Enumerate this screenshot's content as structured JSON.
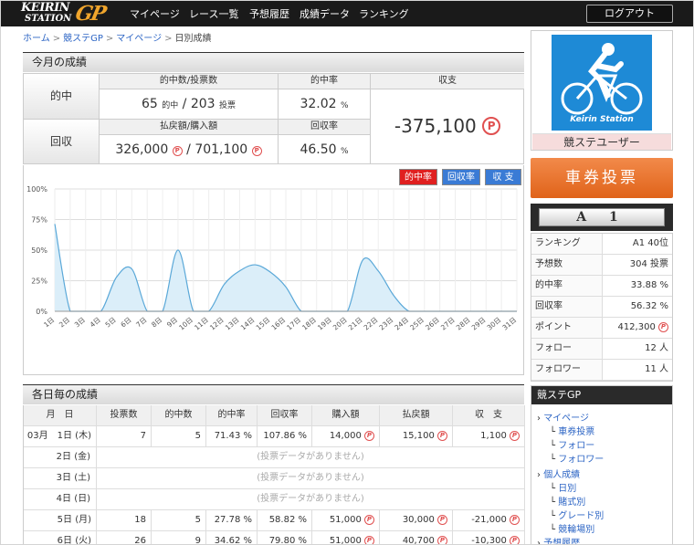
{
  "header": {
    "logo_top": "KEIRIN",
    "logo_bottom": "STATION",
    "logo_gp": "GP",
    "nav": [
      "マイページ",
      "レース一覧",
      "予想履歴",
      "成績データ",
      "ランキング"
    ],
    "logout": "ログアウト"
  },
  "breadcrumb": [
    "ホーム",
    "競ステGP",
    "マイページ",
    "日別成績"
  ],
  "month": {
    "title": "今月の成績",
    "hit_label": "的中",
    "recovery_label": "回収",
    "col_hit_count": "的中数/投票数",
    "col_hit_rate": "的中率",
    "col_balance": "収支",
    "col_payout": "払戻額/購入額",
    "col_recovery_rate": "回収率",
    "hits": "65",
    "hits_unit": "的中",
    "votes": "203",
    "votes_unit": "投票",
    "hit_rate": "32.02",
    "pct": "%",
    "payout": "326,000",
    "purchase": "701,100",
    "recovery_rate": "46.50",
    "balance": "-375,100",
    "p": "P"
  },
  "chart_buttons": [
    "的中率",
    "回収率",
    "収 支"
  ],
  "chart_data": {
    "type": "area",
    "x": [
      "1日",
      "2日",
      "3日",
      "4日",
      "5日",
      "6日",
      "7日",
      "8日",
      "9日",
      "10日",
      "11日",
      "12日",
      "13日",
      "14日",
      "15日",
      "16日",
      "17日",
      "18日",
      "19日",
      "20日",
      "21日",
      "22日",
      "23日",
      "24日",
      "25日",
      "26日",
      "27日",
      "28日",
      "29日",
      "30日",
      "31日"
    ],
    "y": [
      71.4,
      0,
      0,
      0,
      27.8,
      34.6,
      0,
      0,
      50,
      0,
      0,
      22,
      33,
      38,
      32,
      20,
      0,
      0,
      0,
      0,
      42,
      33,
      13,
      0,
      0,
      0,
      0,
      0,
      0,
      0,
      0
    ],
    "yticks": [
      "0%",
      "25%",
      "50%",
      "75%",
      "100%"
    ],
    "ylim": [
      0,
      100
    ]
  },
  "daily": {
    "title": "各日毎の成績",
    "headers": [
      "月　日",
      "投票数",
      "的中数",
      "的中率",
      "回収率",
      "購入額",
      "払戻額",
      "収　支"
    ],
    "rows": [
      {
        "date": "03月　1日 (木)",
        "votes": "7",
        "hits": "5",
        "hit_rate": "71.43 %",
        "rec": "107.86 %",
        "buy": "14,000",
        "pay": "15,100",
        "bal": "1,100"
      },
      {
        "date": "2日 (金)",
        "nodata": "(投票データがありません)"
      },
      {
        "date": "3日 (土)",
        "nodata": "(投票データがありません)"
      },
      {
        "date": "4日 (日)",
        "nodata": "(投票データがありません)"
      },
      {
        "date": "5日 (月)",
        "votes": "18",
        "hits": "5",
        "hit_rate": "27.78 %",
        "rec": "58.82 %",
        "buy": "51,000",
        "pay": "30,000",
        "bal": "-21,000"
      },
      {
        "date": "6日 (火)",
        "votes": "26",
        "hits": "9",
        "hit_rate": "34.62 %",
        "rec": "79.80 %",
        "buy": "51,000",
        "pay": "40,700",
        "bal": "-10,300"
      }
    ]
  },
  "sidebar": {
    "avatar_caption": "Keirin Station",
    "user_name": "競ステユーザー",
    "buy_button": "車券投票",
    "rank": "A 1",
    "stats": [
      {
        "k": "ランキング",
        "v": "A1 40位"
      },
      {
        "k": "予想数",
        "v": "304 投票"
      },
      {
        "k": "的中率",
        "v": "33.88 %"
      },
      {
        "k": "回収率",
        "v": "56.32 %"
      },
      {
        "k": "ポイント",
        "v": "412,300"
      },
      {
        "k": "フォロー",
        "v": "12 人"
      },
      {
        "k": "フォロワー",
        "v": "11 人"
      }
    ],
    "subnav_title": "競ステGP",
    "subnav": [
      "マイページ",
      "車券投票",
      "フォロー",
      "フォロワー",
      "個人成績",
      "日別",
      "賭式別",
      "グレード別",
      "競輪場別",
      "予想履歴"
    ]
  }
}
